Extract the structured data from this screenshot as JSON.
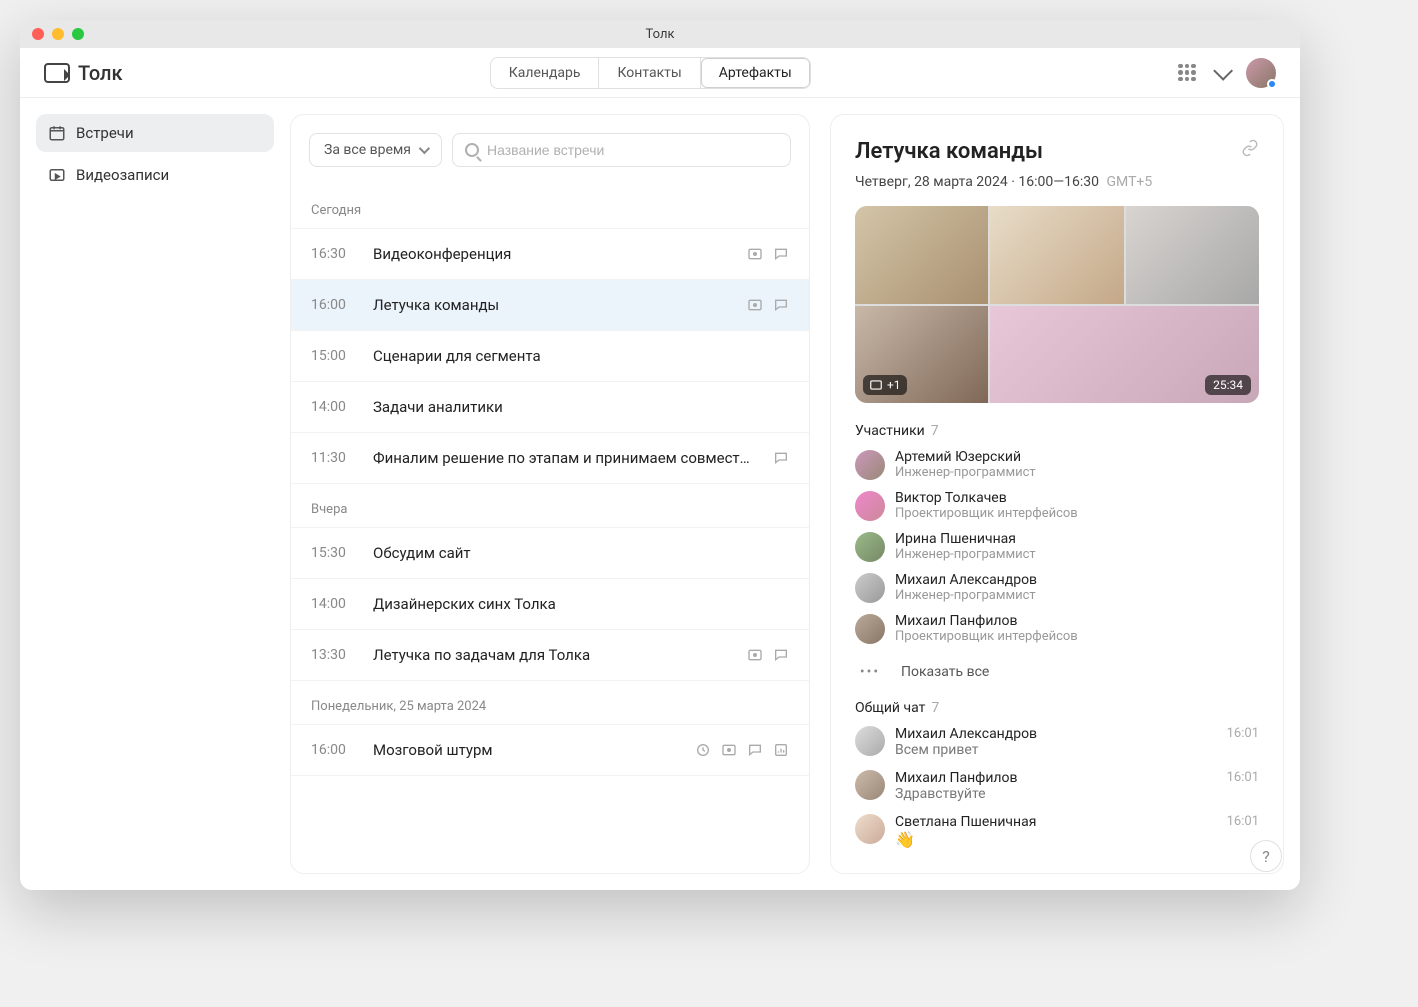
{
  "window": {
    "title": "Толк"
  },
  "brand": {
    "name": "Толк"
  },
  "tabs": {
    "calendar": "Календарь",
    "contacts": "Контакты",
    "artifacts": "Артефакты"
  },
  "sidebar": {
    "meetings": "Встречи",
    "recordings": "Видеозаписи"
  },
  "filter": {
    "label": "За все время"
  },
  "search": {
    "placeholder": "Название встречи"
  },
  "groups": {
    "today": "Сегодня",
    "yesterday": "Вчера",
    "mon": "Понедельник, 25 марта 2024"
  },
  "meetings": {
    "m1": {
      "time": "16:30",
      "title": "Видеоконференция"
    },
    "m2": {
      "time": "16:00",
      "title": "Летучка команды"
    },
    "m3": {
      "time": "15:00",
      "title": "Сценарии для сегмента"
    },
    "m4": {
      "time": "14:00",
      "title": "Задачи аналитики"
    },
    "m5": {
      "time": "11:30",
      "title": "Финалим решение по этапам и принимаем совместное р…"
    },
    "m6": {
      "time": "15:30",
      "title": "Обсудим сайт"
    },
    "m7": {
      "time": "14:00",
      "title": "Дизайнерских синх Толка"
    },
    "m8": {
      "time": "13:30",
      "title": "Летучка по задачам для Толка"
    },
    "m9": {
      "time": "16:00",
      "title": "Мозговой штурм"
    }
  },
  "detail": {
    "title": "Летучка команды",
    "date": "Четверг, 28 марта 2024 · 16:00—16:30",
    "tz": "GMT+5",
    "duration": "25:34",
    "participants_label": "Участники",
    "participants_count": "7",
    "chat_label": "Общий чат",
    "chat_count": "7",
    "show_all": "Показать все"
  },
  "participants": {
    "p1": {
      "name": "Артемий Юзерский",
      "role": "Инженер-программист"
    },
    "p2": {
      "name": "Виктор Толкачев",
      "role": "Проектировщик интерфейсов"
    },
    "p3": {
      "name": "Ирина Пшеничная",
      "role": "Инженер-программист"
    },
    "p4": {
      "name": "Михаил Александров",
      "role": "Инженер-программист"
    },
    "p5": {
      "name": "Михаил Панфилов",
      "role": "Проектировщик интерфейсов"
    }
  },
  "chat": {
    "c1": {
      "name": "Михаил Александров",
      "msg": "Всем привет",
      "time": "16:01"
    },
    "c2": {
      "name": "Михаил Панфилов",
      "msg": "Здравствуйте",
      "time": "16:01"
    },
    "c3": {
      "name": "Светлана Пшеничная",
      "msg": "👋",
      "time": "16:01"
    }
  },
  "help": "?"
}
